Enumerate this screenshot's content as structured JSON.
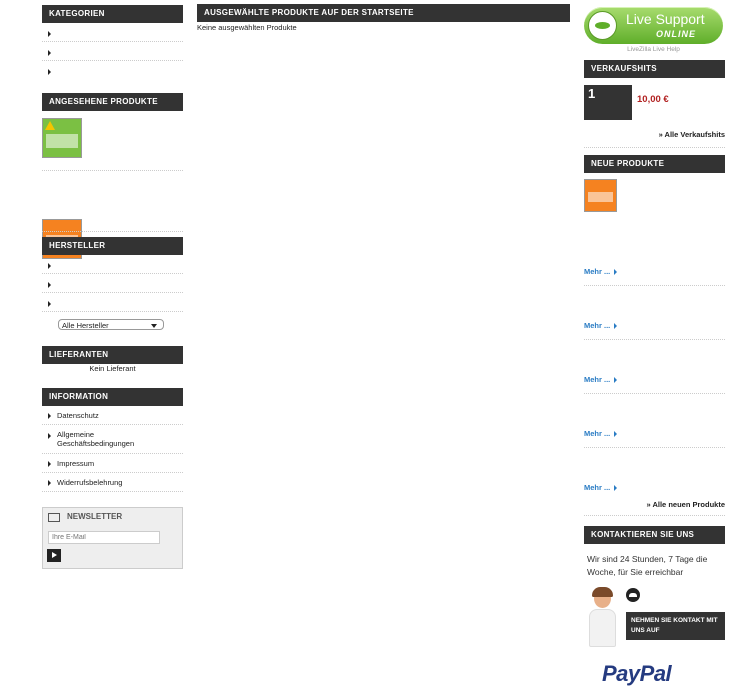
{
  "left": {
    "categories": {
      "title": "KATEGORIEN",
      "items": [
        "",
        "",
        ""
      ]
    },
    "viewed": {
      "title": "ANGESEHENE PRODUKTE"
    },
    "manufacturers": {
      "title": "HERSTELLER",
      "items": [
        "",
        "",
        ""
      ],
      "select_value": "Alle Hersteller"
    },
    "suppliers": {
      "title": "LIEFERANTEN",
      "text": "Kein Lieferant"
    },
    "information": {
      "title": "INFORMATION",
      "items": [
        "Datenschutz",
        "Allgemeine Geschäftsbedingungen",
        "Impressum",
        "Widerrufsbelehrung"
      ]
    },
    "newsletter": {
      "title": "NEWSLETTER",
      "placeholder": "Ihre E-Mail"
    }
  },
  "center": {
    "title": "AUSGEWÄHLTE PRODUKTE AUF DER STARTSEITE",
    "empty_text": "Keine ausgewählten Produkte"
  },
  "right": {
    "live_support": {
      "line1": "Live Support",
      "line2": "ONLINE",
      "caption": "LiveZilla Live Help"
    },
    "bestsellers": {
      "title": "VERKAUFSHITS",
      "rank": "1",
      "price": "10,00 €",
      "all_link": "» Alle Verkaufshits"
    },
    "new_products": {
      "title": "NEUE PRODUKTE",
      "more_label": "Mehr ...",
      "all_link": "» Alle neuen Produkte"
    },
    "contact": {
      "title": "KONTAKTIEREN SIE UNS",
      "text": "Wir sind 24 Stunden, 7 Tage die Woche, für Sie erreichbar",
      "button": "NEHMEN SIE KONTAKT MIT UNS AUF"
    },
    "paypal": {
      "text": "PayPal"
    }
  },
  "colors": {
    "bar": "#333333",
    "accent_blue": "#2a7cc4",
    "price_red": "#b22222",
    "live_green": "#7cc242"
  }
}
